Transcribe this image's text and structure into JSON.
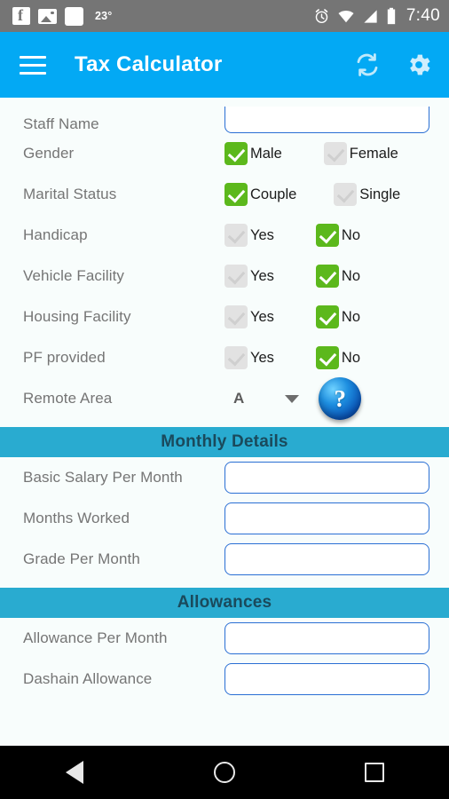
{
  "status_bar": {
    "icons": [
      "facebook-icon",
      "image-icon",
      "blank-app-icon"
    ],
    "temperature": "23°",
    "right_icons": [
      "alarm-icon",
      "wifi-icon",
      "signal-icon",
      "battery-icon"
    ],
    "time": "7:40"
  },
  "app_bar": {
    "menu_icon": "hamburger-menu-icon",
    "title": "Tax Calculator",
    "refresh_icon": "refresh-icon",
    "settings_icon": "gear-icon"
  },
  "form": {
    "staff_name": {
      "label": "Staff Name",
      "value": "",
      "placeholder": ""
    },
    "gender": {
      "label": "Gender",
      "options": [
        {
          "label": "Male",
          "checked": true
        },
        {
          "label": "Female",
          "checked": false
        }
      ]
    },
    "marital_status": {
      "label": "Marital Status",
      "options": [
        {
          "label": "Couple",
          "checked": true
        },
        {
          "label": "Single",
          "checked": false
        }
      ]
    },
    "handicap": {
      "label": "Handicap",
      "options": [
        {
          "label": "Yes",
          "checked": false
        },
        {
          "label": "No",
          "checked": true
        }
      ]
    },
    "vehicle_facility": {
      "label": "Vehicle Facility",
      "options": [
        {
          "label": "Yes",
          "checked": false
        },
        {
          "label": "No",
          "checked": true
        }
      ]
    },
    "housing_facility": {
      "label": "Housing Facility",
      "options": [
        {
          "label": "Yes",
          "checked": false
        },
        {
          "label": "No",
          "checked": true
        }
      ]
    },
    "pf_provided": {
      "label": "PF provided",
      "options": [
        {
          "label": "Yes",
          "checked": false
        },
        {
          "label": "No",
          "checked": true
        }
      ]
    },
    "remote_area": {
      "label": "Remote Area",
      "selected": "A",
      "dropdown_icon": "chevron-down-icon",
      "help_icon": "?"
    }
  },
  "monthly_details": {
    "section_title": "Monthly Details",
    "fields": [
      {
        "label": "Basic Salary Per Month",
        "value": "",
        "placeholder": ""
      },
      {
        "label": "Months Worked",
        "value": "",
        "placeholder": ""
      },
      {
        "label": "Grade Per Month",
        "value": "",
        "placeholder": ""
      }
    ]
  },
  "allowances": {
    "section_title": "Allowances",
    "fields": [
      {
        "label": "Allowance Per Month",
        "value": "",
        "placeholder": ""
      },
      {
        "label": "Dashain Allowance",
        "value": "",
        "placeholder": ""
      }
    ]
  },
  "nav_bar": {
    "back": "back-triangle-icon",
    "home": "home-circle-icon",
    "recents": "recents-square-icon"
  },
  "colors": {
    "status_bar": "#757575",
    "app_bar": "#03a9f4",
    "section_band": "#29abd0",
    "section_text": "#1a4a5c",
    "checkbox_on": "#5cb81c",
    "checkbox_off": "#e2e2e2",
    "input_border": "#2a6fd4",
    "background": "#f8fdfc",
    "label_text": "#757575"
  }
}
